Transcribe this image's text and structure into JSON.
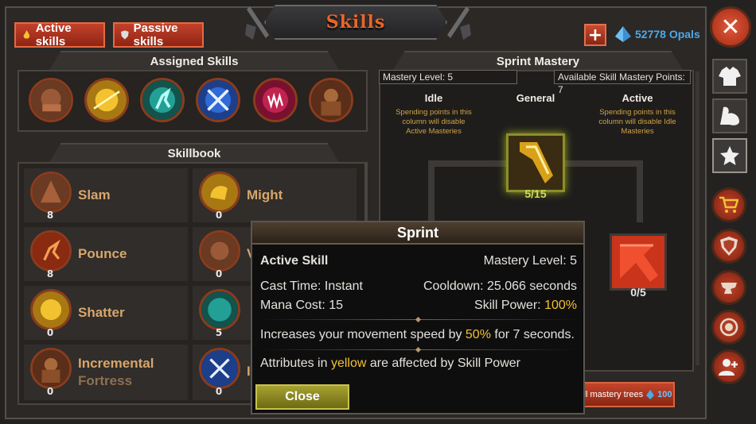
{
  "title": "Skills",
  "tabs": {
    "active": "Active skills",
    "passive": "Passive skills"
  },
  "currency": {
    "amount": "52778 Opals",
    "plus": "+"
  },
  "assigned": {
    "header": "Assigned Skills",
    "slots": [
      "slam",
      "shatter",
      "pounce-teal",
      "crossed-swords",
      "fang",
      "incremental-fortress"
    ]
  },
  "skillbook": {
    "header": "Skillbook",
    "items": [
      {
        "name": "Slam",
        "level": "8"
      },
      {
        "name": "Might",
        "level": "0"
      },
      {
        "name": "Pounce",
        "level": "8"
      },
      {
        "name": "V",
        "level": "0"
      },
      {
        "name": "Shatter",
        "level": "0"
      },
      {
        "name": "",
        "level": "5"
      },
      {
        "name": "Incremental",
        "name2": "Fortress",
        "level": "0"
      },
      {
        "name": "I",
        "level": "0"
      }
    ]
  },
  "mastery": {
    "header": "Sprint Mastery",
    "level": "Mastery Level: 5",
    "points": "Available Skill Mastery Points: 7",
    "columns": {
      "idle": "Idle",
      "general": "General",
      "active": "Active"
    },
    "idle_note": "Spending points in this column will disable Active Masteries",
    "active_note": "Spending points in this column will disable Idle Masteries",
    "general_count": "5/15",
    "active_count": "0/5",
    "reset_label": "ll mastery trees",
    "reset_cost": "100"
  },
  "tooltip": {
    "title": "Sprint",
    "type": "Active Skill",
    "mastery": "Mastery Level: 5",
    "cast": "Cast Time: Instant",
    "cooldown": "Cooldown: 25.066 seconds",
    "mana": "Mana Cost: 15",
    "power_label": "Skill Power: ",
    "power_value": "100%",
    "desc_a": "Increases your movement speed by ",
    "desc_pct": "50%",
    "desc_b": " for 7 seconds.",
    "attr_a": "Attributes in ",
    "attr_yellow": "yellow",
    "attr_b": " are affected by Skill Power",
    "close": "Close"
  },
  "colors": {
    "accent": "#e8652a",
    "opal": "#4ea9e6",
    "highlight": "#f2c230",
    "skill_name": "#d8a66a"
  },
  "rail_icons": [
    "close-icon",
    "armor-icon",
    "arm-icon",
    "star-icon",
    "cart-icon",
    "shield-icon",
    "anvil-icon",
    "medal-icon",
    "add-friend-icon"
  ]
}
